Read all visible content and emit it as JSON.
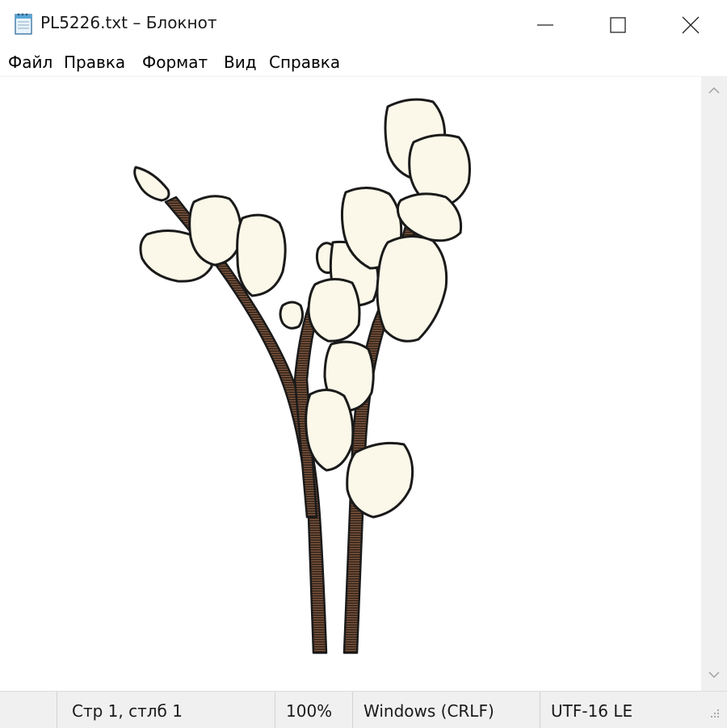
{
  "window": {
    "title": "PL5226.txt – Блокнот",
    "app_icon": "notepad-icon",
    "controls": {
      "minimize": "minimize-icon",
      "maximize": "maximize-icon",
      "close": "close-icon"
    }
  },
  "menu": {
    "items": [
      {
        "label": "Файл"
      },
      {
        "label": "Правка"
      },
      {
        "label": "Формат"
      },
      {
        "label": "Вид"
      },
      {
        "label": "Справка"
      }
    ]
  },
  "editor": {
    "content": "ASCII/text art of pussy willow branches with fluffy catkins"
  },
  "status": {
    "position": "Стр 1, стлб 1",
    "zoom": "100%",
    "line_endings": "Windows (CRLF)",
    "encoding": "UTF-16 LE"
  },
  "colors": {
    "catkin_fill": "#fbf8e9",
    "catkin_outline": "#1a1a1a",
    "stem": "#5a4030",
    "chrome_gray": "#f0f0f0"
  }
}
